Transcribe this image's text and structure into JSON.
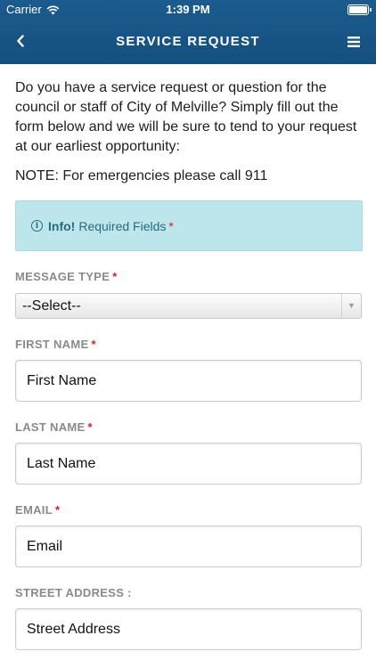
{
  "status_bar": {
    "carrier": "Carrier",
    "time": "1:39 PM"
  },
  "header": {
    "title": "SERVICE REQUEST",
    "back_icon": "chevron-left-icon",
    "menu_icon": "hamburger-menu-icon",
    "background_color": "#1a5689"
  },
  "intro": {
    "text": "Do you have a service request or question for the council or staff of City of Melville? Simply fill out the form below and we will be sure to tend to your request at our earliest opportunity:",
    "note": "NOTE: For emergencies please call 911"
  },
  "info": {
    "icon": "info-circle-icon",
    "strong": "Info!",
    "text": "Required Fields",
    "asterisk": "*",
    "background_color": "#bde6ec"
  },
  "form": {
    "message_type": {
      "label": "MESSAGE TYPE",
      "required": "*",
      "selected": "--Select--"
    },
    "first_name": {
      "label": "FIRST NAME",
      "required": "*",
      "placeholder": "First Name"
    },
    "last_name": {
      "label": "LAST NAME",
      "required": "*",
      "placeholder": "Last Name"
    },
    "email": {
      "label": "EMAIL",
      "required": "*",
      "placeholder": "Email"
    },
    "street_address": {
      "label": "STREET ADDRESS :",
      "placeholder": "Street Address"
    }
  }
}
